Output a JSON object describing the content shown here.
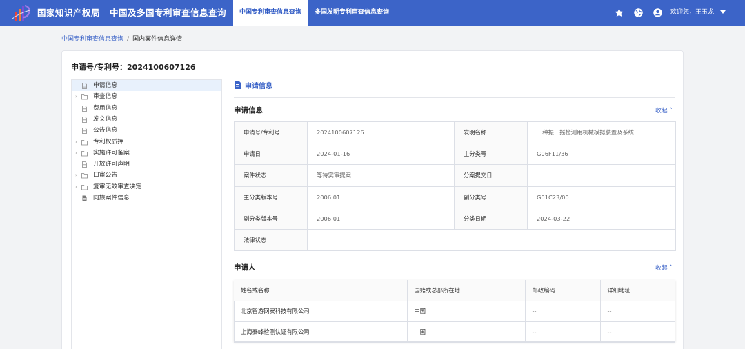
{
  "header": {
    "org_name": "国家知识产权局",
    "site_title": "中国及多国专利审查信息查询",
    "tabs": [
      {
        "label": "中国专利审查信息查询",
        "active": true
      },
      {
        "label": "多国发明专利审查信息查询",
        "active": false
      }
    ],
    "icons": [
      "star-icon",
      "globe-icon",
      "account-icon"
    ],
    "welcome": "欢迎您，王玉龙",
    "bg_color": "#3c64c8"
  },
  "breadcrumb": {
    "root": "中国专利审查信息查询",
    "separator": "/",
    "current": "国内案件信息详情"
  },
  "page": {
    "app_number_label": "申请号/专利号：2024100607126"
  },
  "sidebar": {
    "items": [
      {
        "label": "申请信息",
        "type": "doc",
        "expandable": false,
        "selected": true
      },
      {
        "label": "审查信息",
        "type": "folder",
        "expandable": true,
        "selected": false
      },
      {
        "label": "费用信息",
        "type": "doc",
        "expandable": false,
        "selected": false
      },
      {
        "label": "发文信息",
        "type": "doc",
        "expandable": false,
        "selected": false
      },
      {
        "label": "公告信息",
        "type": "doc",
        "expandable": false,
        "selected": false
      },
      {
        "label": "专利权质押",
        "type": "folder",
        "expandable": true,
        "selected": false
      },
      {
        "label": "实施许可备案",
        "type": "folder",
        "expandable": true,
        "selected": false
      },
      {
        "label": "开放许可声明",
        "type": "doc",
        "expandable": false,
        "selected": false
      },
      {
        "label": "口审公告",
        "type": "folder",
        "expandable": true,
        "selected": false
      },
      {
        "label": "复审无效审查决定",
        "type": "folder",
        "expandable": true,
        "selected": false
      },
      {
        "label": "同族案件信息",
        "type": "doc-filled",
        "expandable": false,
        "selected": false
      }
    ]
  },
  "main": {
    "section_title": "申请信息",
    "application": {
      "title": "申请信息",
      "collapse_label": "收起",
      "rows": [
        [
          "申请号/专利号",
          "2024100607126",
          "发明名称",
          "一种振一摇检测用机械模拟装置及系统"
        ],
        [
          "申请日",
          "2024-01-16",
          "主分类号",
          "G06F11/36"
        ],
        [
          "案件状态",
          "等待实审提案",
          "分案提交日",
          ""
        ],
        [
          "主分类版本号",
          "2006.01",
          "副分类号",
          "G01C23/00"
        ],
        [
          "副分类版本号",
          "2006.01",
          "分类日期",
          "2024-03-22"
        ],
        [
          "法律状态",
          "",
          "",
          ""
        ]
      ]
    },
    "applicants": {
      "title": "申请人",
      "collapse_label": "收起",
      "columns": [
        "姓名或名称",
        "国籍或总部所在地",
        "邮政编码",
        "详细地址"
      ],
      "rows": [
        [
          "北京智游网安科技有限公司",
          "中国",
          "--",
          "--"
        ],
        [
          "上海泰峰检测认证有限公司",
          "中国",
          "--",
          "--"
        ]
      ]
    }
  }
}
